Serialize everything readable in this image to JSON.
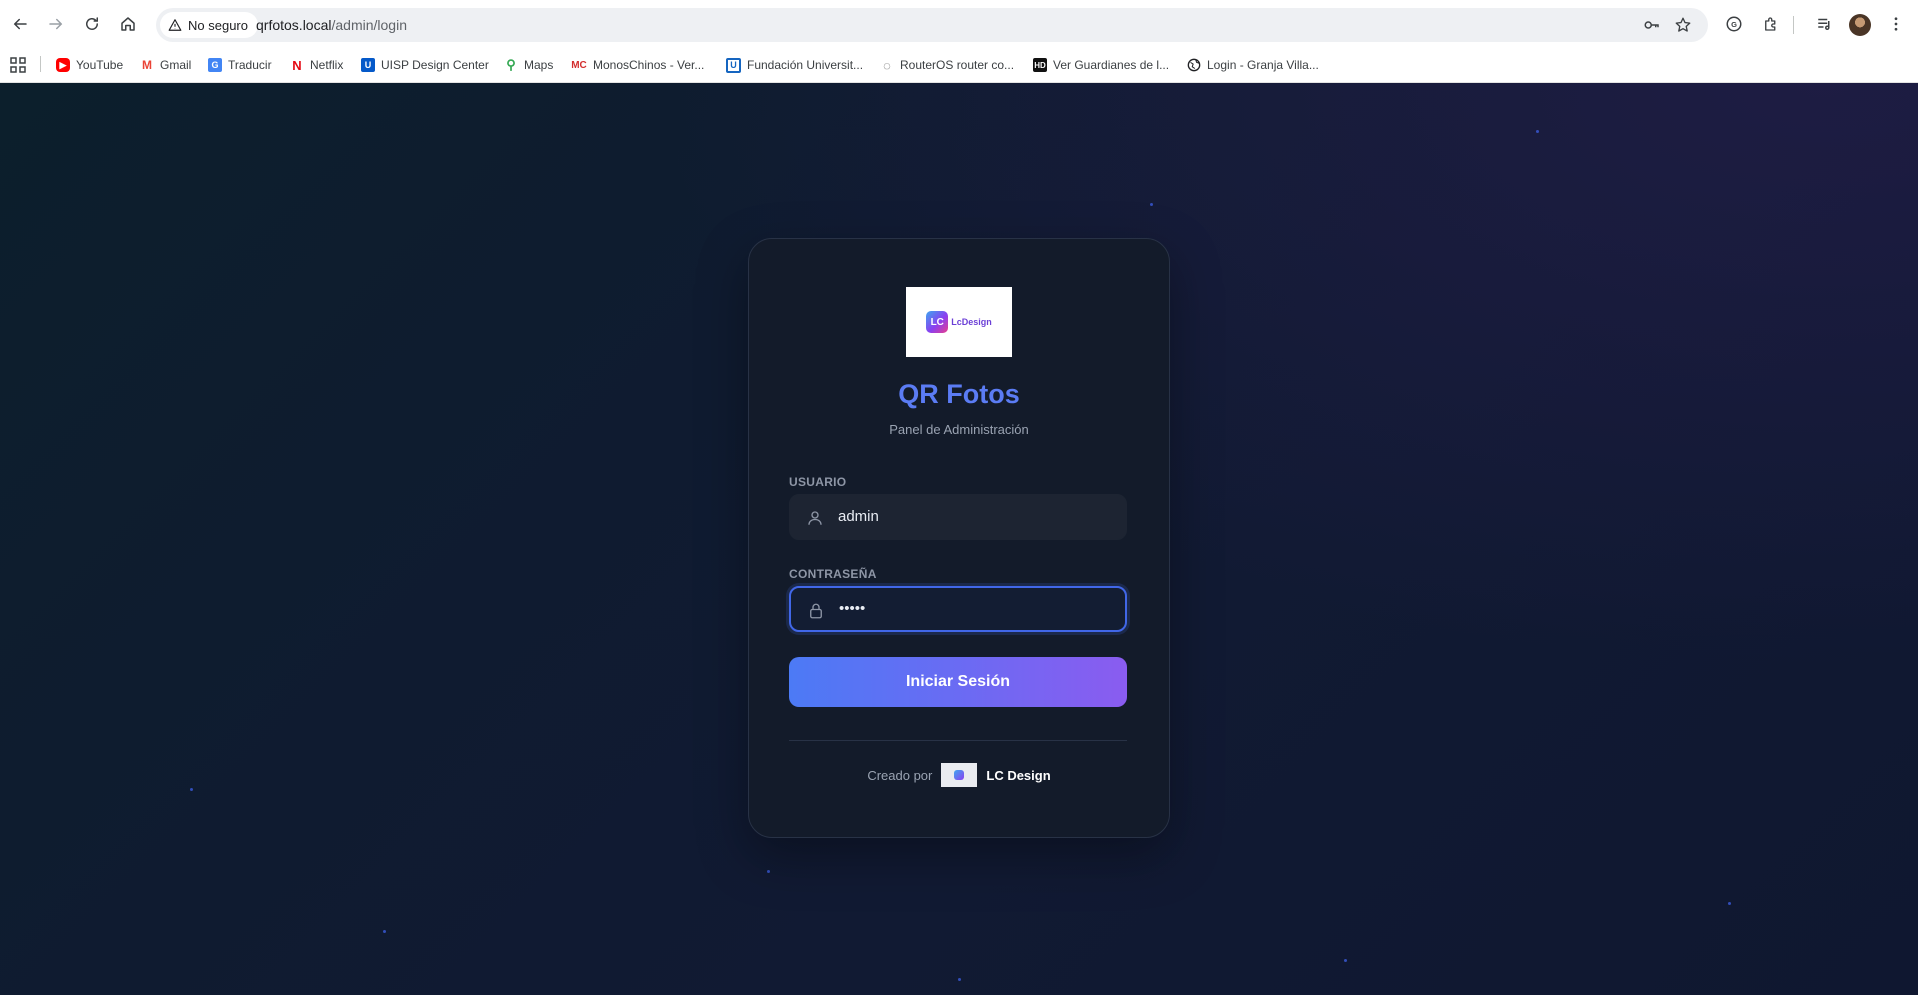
{
  "browser": {
    "security_label": "No seguro",
    "url_host": "qrfotos.local",
    "url_path": "/admin/login"
  },
  "bookmarks": [
    {
      "label": "YouTube",
      "icon": "youtube-icon"
    },
    {
      "label": "Gmail",
      "icon": "gmail-icon"
    },
    {
      "label": "Traducir",
      "icon": "translate-icon"
    },
    {
      "label": "Netflix",
      "icon": "netflix-icon"
    },
    {
      "label": "UISP Design Center",
      "icon": "uisp-icon"
    },
    {
      "label": "Maps",
      "icon": "maps-icon"
    },
    {
      "label": "MonosChinos - Ver...",
      "icon": "monoschinos-icon"
    },
    {
      "label": "Fundación Universit...",
      "icon": "university-icon"
    },
    {
      "label": "RouterOS router co...",
      "icon": "routeros-icon"
    },
    {
      "label": "Ver Guardianes de l...",
      "icon": "hd-icon"
    },
    {
      "label": "Login - Granja Villa...",
      "icon": "globe-icon"
    }
  ],
  "login": {
    "logo_text": "LcDesign",
    "title": "QR Fotos",
    "subtitle": "Panel de Administración",
    "username_label": "USUARIO",
    "username_value": "admin",
    "password_label": "CONTRASEÑA",
    "password_value": "•••••",
    "submit_label": "Iniciar Sesión",
    "footer_prefix": "Creado por",
    "footer_brand": "LC Design"
  },
  "colors": {
    "accent": "#5b7cf4",
    "button_start": "#4c7af5",
    "button_end": "#8a5cf0",
    "card_bg": "#131b2a",
    "page_bg": "#0f1b30"
  }
}
